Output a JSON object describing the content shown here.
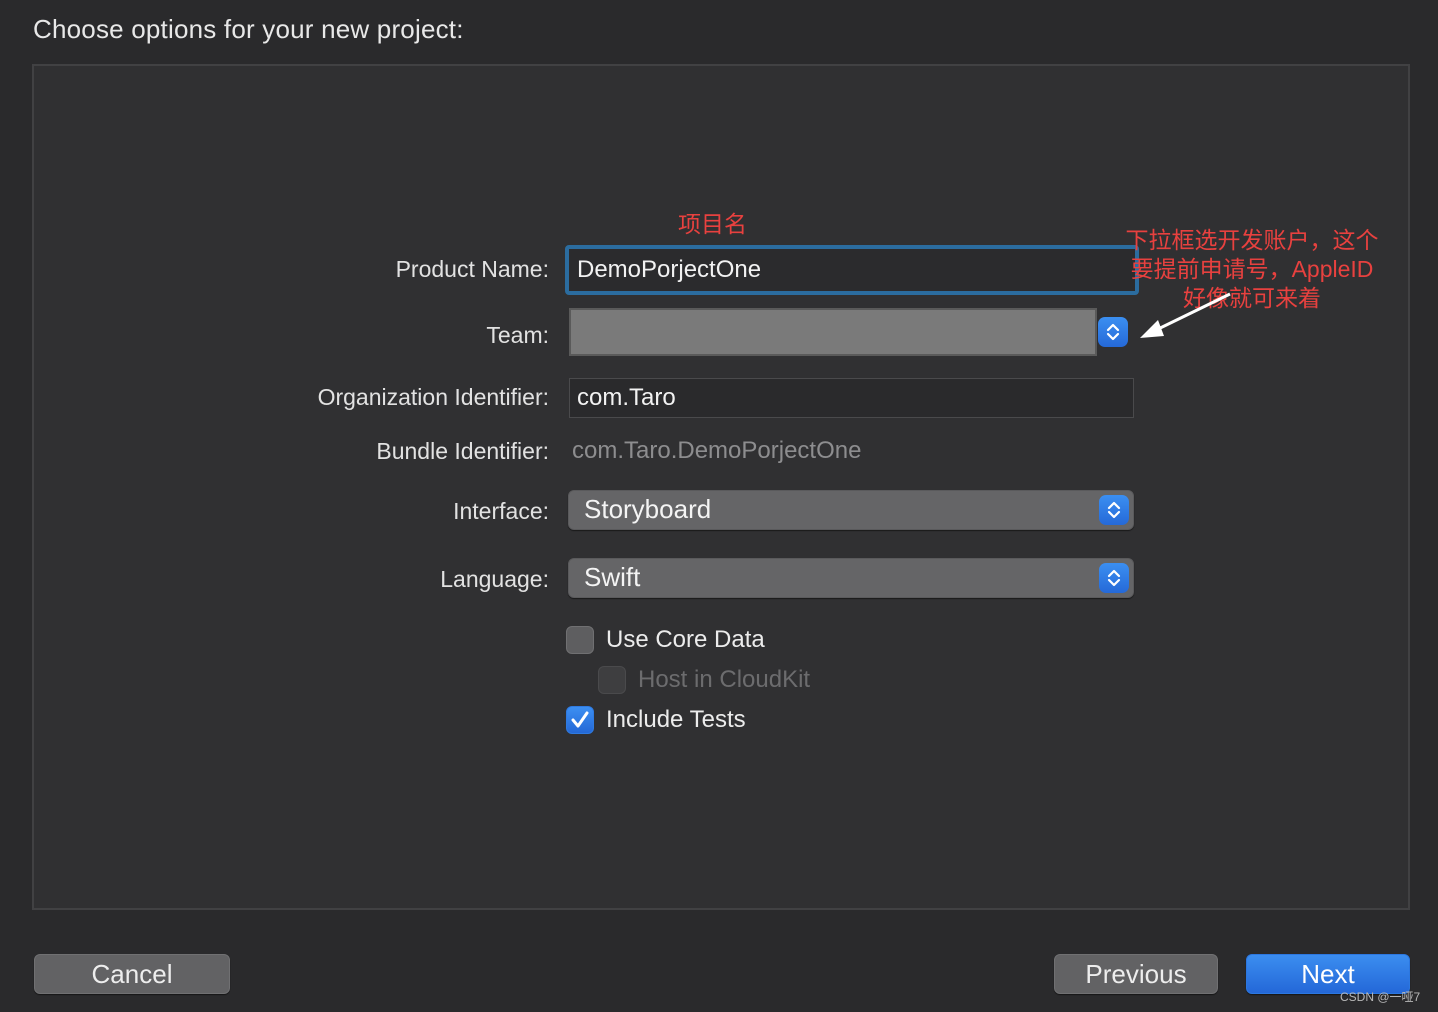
{
  "header": {
    "title": "Choose options for your new project:"
  },
  "form": {
    "product_name": {
      "label": "Product Name:",
      "value": "DemoPorjectOne"
    },
    "team": {
      "label": "Team:",
      "value": ""
    },
    "organization_identifier": {
      "label": "Organization Identifier:",
      "value": "com.Taro"
    },
    "bundle_identifier": {
      "label": "Bundle Identifier:",
      "value": "com.Taro.DemoPorjectOne"
    },
    "interface": {
      "label": "Interface:",
      "value": "Storyboard"
    },
    "language": {
      "label": "Language:",
      "value": "Swift"
    },
    "use_core_data": {
      "label": "Use Core Data",
      "checked": false
    },
    "host_in_cloudkit": {
      "label": "Host in CloudKit",
      "checked": false,
      "disabled": true
    },
    "include_tests": {
      "label": "Include Tests",
      "checked": true
    }
  },
  "annotations": {
    "product_name_note": "项目名",
    "team_note_line1": "下拉框选开发账户，这个",
    "team_note_line2": "要提前申请号，AppleID",
    "team_note_line3": "好像就可来着"
  },
  "buttons": {
    "cancel": "Cancel",
    "previous": "Previous",
    "next": "Next"
  },
  "watermark": "CSDN @一哑7",
  "colors": {
    "accent": "#2f7ae0",
    "annotation": "#e8413f",
    "focus_ring": "#2b6c9f"
  },
  "icons": {
    "stepper": "chevron-up-down-icon",
    "checkmark": "checkmark-icon",
    "arrow": "arrow-icon"
  }
}
